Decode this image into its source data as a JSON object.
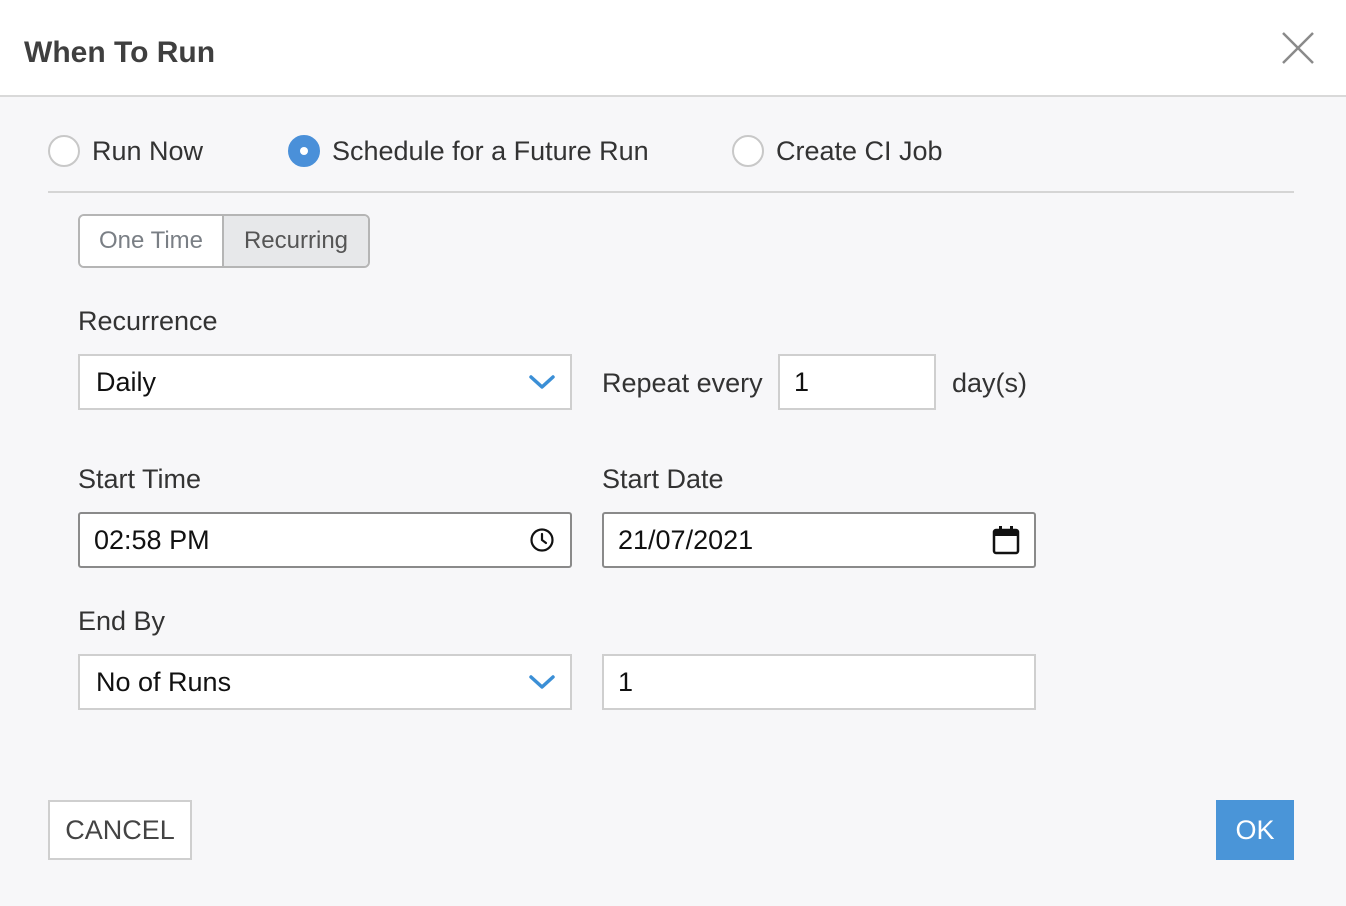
{
  "dialog": {
    "title": "When To Run"
  },
  "run_mode": {
    "options": [
      {
        "label": "Run Now",
        "selected": false
      },
      {
        "label": "Schedule for a Future Run",
        "selected": true
      },
      {
        "label": "Create CI Job",
        "selected": false
      }
    ]
  },
  "schedule_type": {
    "options": [
      "One Time",
      "Recurring"
    ],
    "selected": "Recurring"
  },
  "recurrence": {
    "label": "Recurrence",
    "value": "Daily",
    "repeat_label": "Repeat every",
    "repeat_value": "1",
    "repeat_unit": "day(s)"
  },
  "start_time": {
    "label": "Start Time",
    "value": "02:58  PM"
  },
  "start_date": {
    "label": "Start Date",
    "value": "21/07/2021"
  },
  "end_by": {
    "label": "End By",
    "value": "No of Runs",
    "count_value": "1"
  },
  "actions": {
    "cancel_label": "CANCEL",
    "ok_label": "OK"
  },
  "colors": {
    "accent": "#4a95d8",
    "chevron": "#3b8fd6"
  },
  "icons": {
    "close": "close-icon",
    "chevron": "chevron-down-icon",
    "clock": "clock-icon",
    "calendar": "calendar-icon"
  }
}
